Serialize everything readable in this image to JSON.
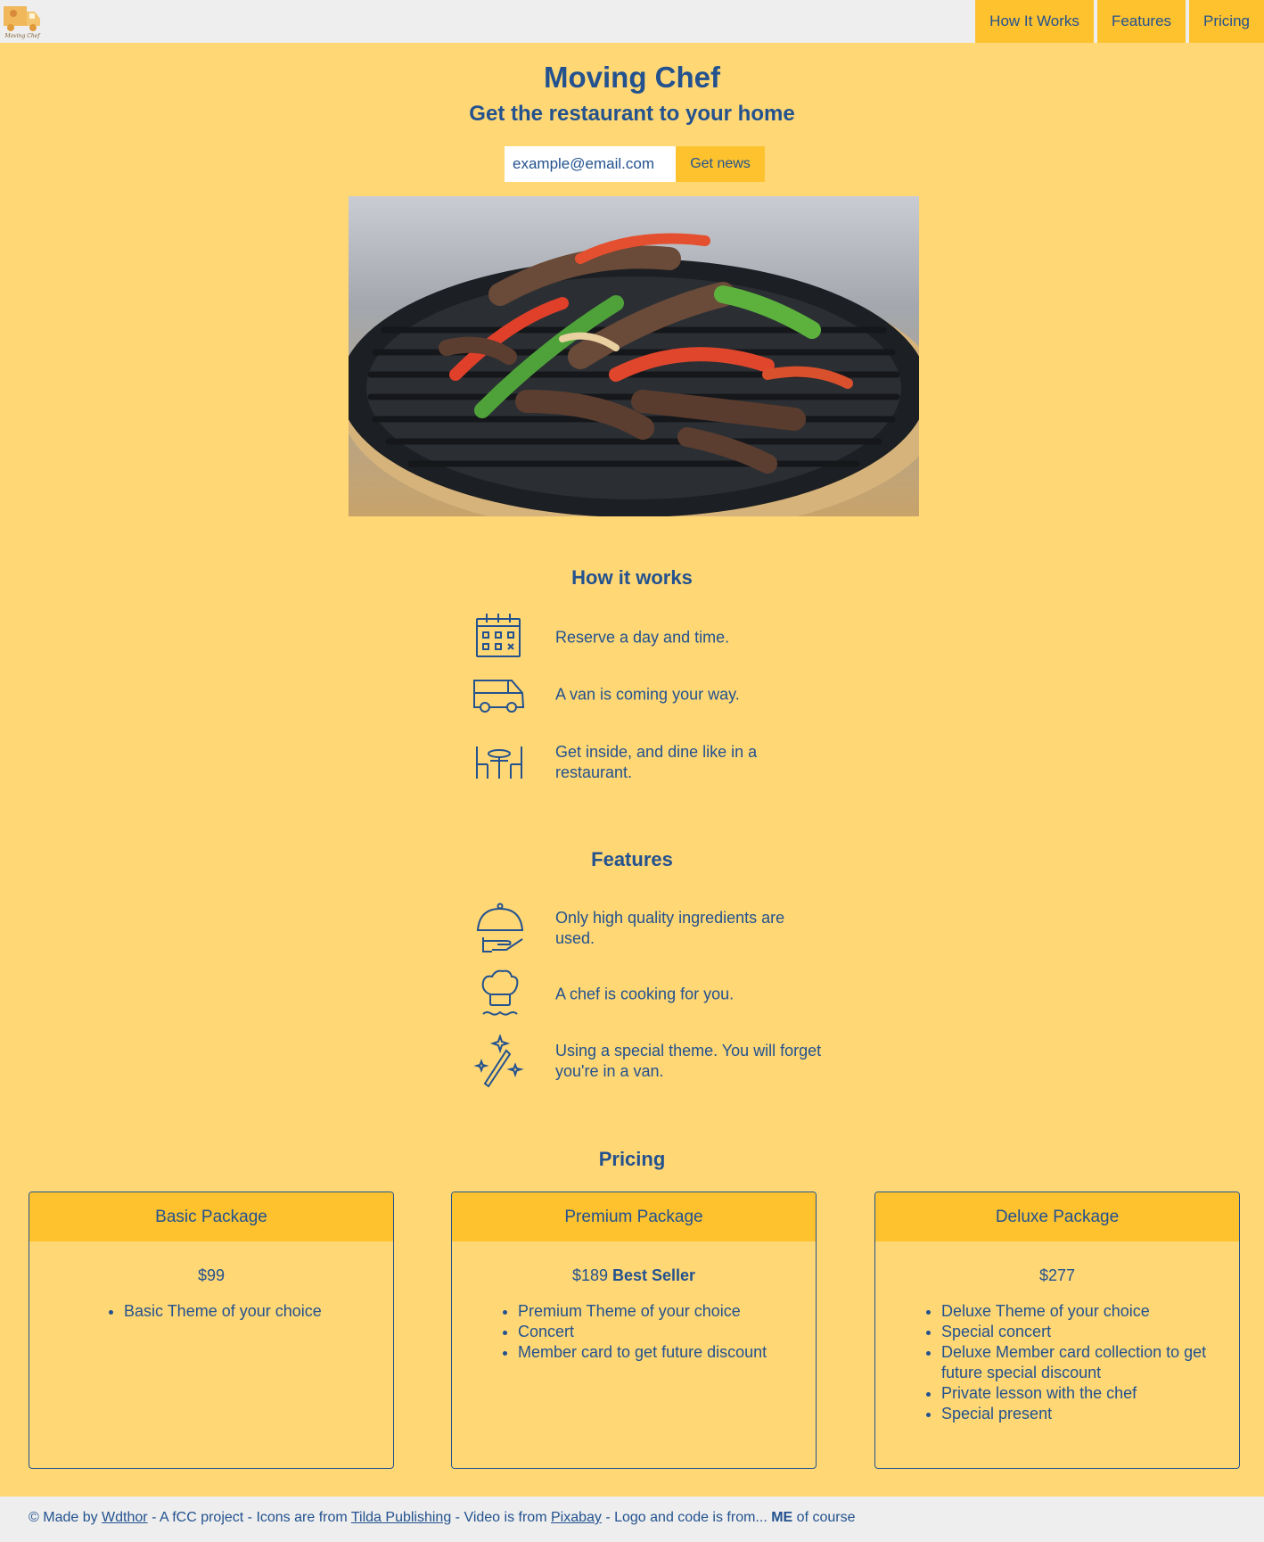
{
  "header": {
    "logo_text": "Moving Chef",
    "nav": [
      "How It Works",
      "Features",
      "Pricing"
    ]
  },
  "hero": {
    "title": "Moving Chef",
    "subtitle": "Get the restaurant to your home",
    "email_placeholder": "example@email.com",
    "submit_label": "Get news"
  },
  "how": {
    "title": "How it works",
    "items": [
      {
        "icon": "calendar-icon",
        "text": "Reserve a day and time."
      },
      {
        "icon": "van-icon",
        "text": "A van is coming your way."
      },
      {
        "icon": "dining-table-icon",
        "text": "Get inside, and dine like in a restaurant."
      }
    ]
  },
  "features": {
    "title": "Features",
    "items": [
      {
        "icon": "cloche-serving-icon",
        "text": "Only high quality ingredients are used."
      },
      {
        "icon": "chef-hat-icon",
        "text": "A chef is cooking for you."
      },
      {
        "icon": "magic-wand-icon",
        "text": "Using a special theme. You will forget you're in a van."
      }
    ]
  },
  "pricing": {
    "title": "Pricing",
    "packages": [
      {
        "name": "Basic Package",
        "price": "$99",
        "badge": "",
        "features": [
          "Basic Theme of your choice"
        ]
      },
      {
        "name": "Premium Package",
        "price": "$189",
        "badge": "Best Seller",
        "features": [
          "Premium Theme of your choice",
          "Concert",
          "Member card to get future discount"
        ]
      },
      {
        "name": "Deluxe Package",
        "price": "$277",
        "badge": "",
        "features": [
          "Deluxe Theme of your choice",
          "Special concert",
          "Deluxe Member card collection to get future special discount",
          "Private lesson with the chef",
          "Special present"
        ]
      }
    ]
  },
  "footer": {
    "p1": "© Made by ",
    "author": "Wdthor",
    "p2": " - A fCC project  - Icons are from ",
    "icons_src": "Tilda Publishing",
    "p3": "  - Video is from ",
    "video_src": "Pixabay",
    "p4": "  - Logo and code is from... ",
    "me": "ME",
    "p5": " of course"
  },
  "colors": {
    "background": "#ffd775",
    "accent": "#fdc22e",
    "text": "#23528f",
    "topbar": "#eeeeee"
  }
}
